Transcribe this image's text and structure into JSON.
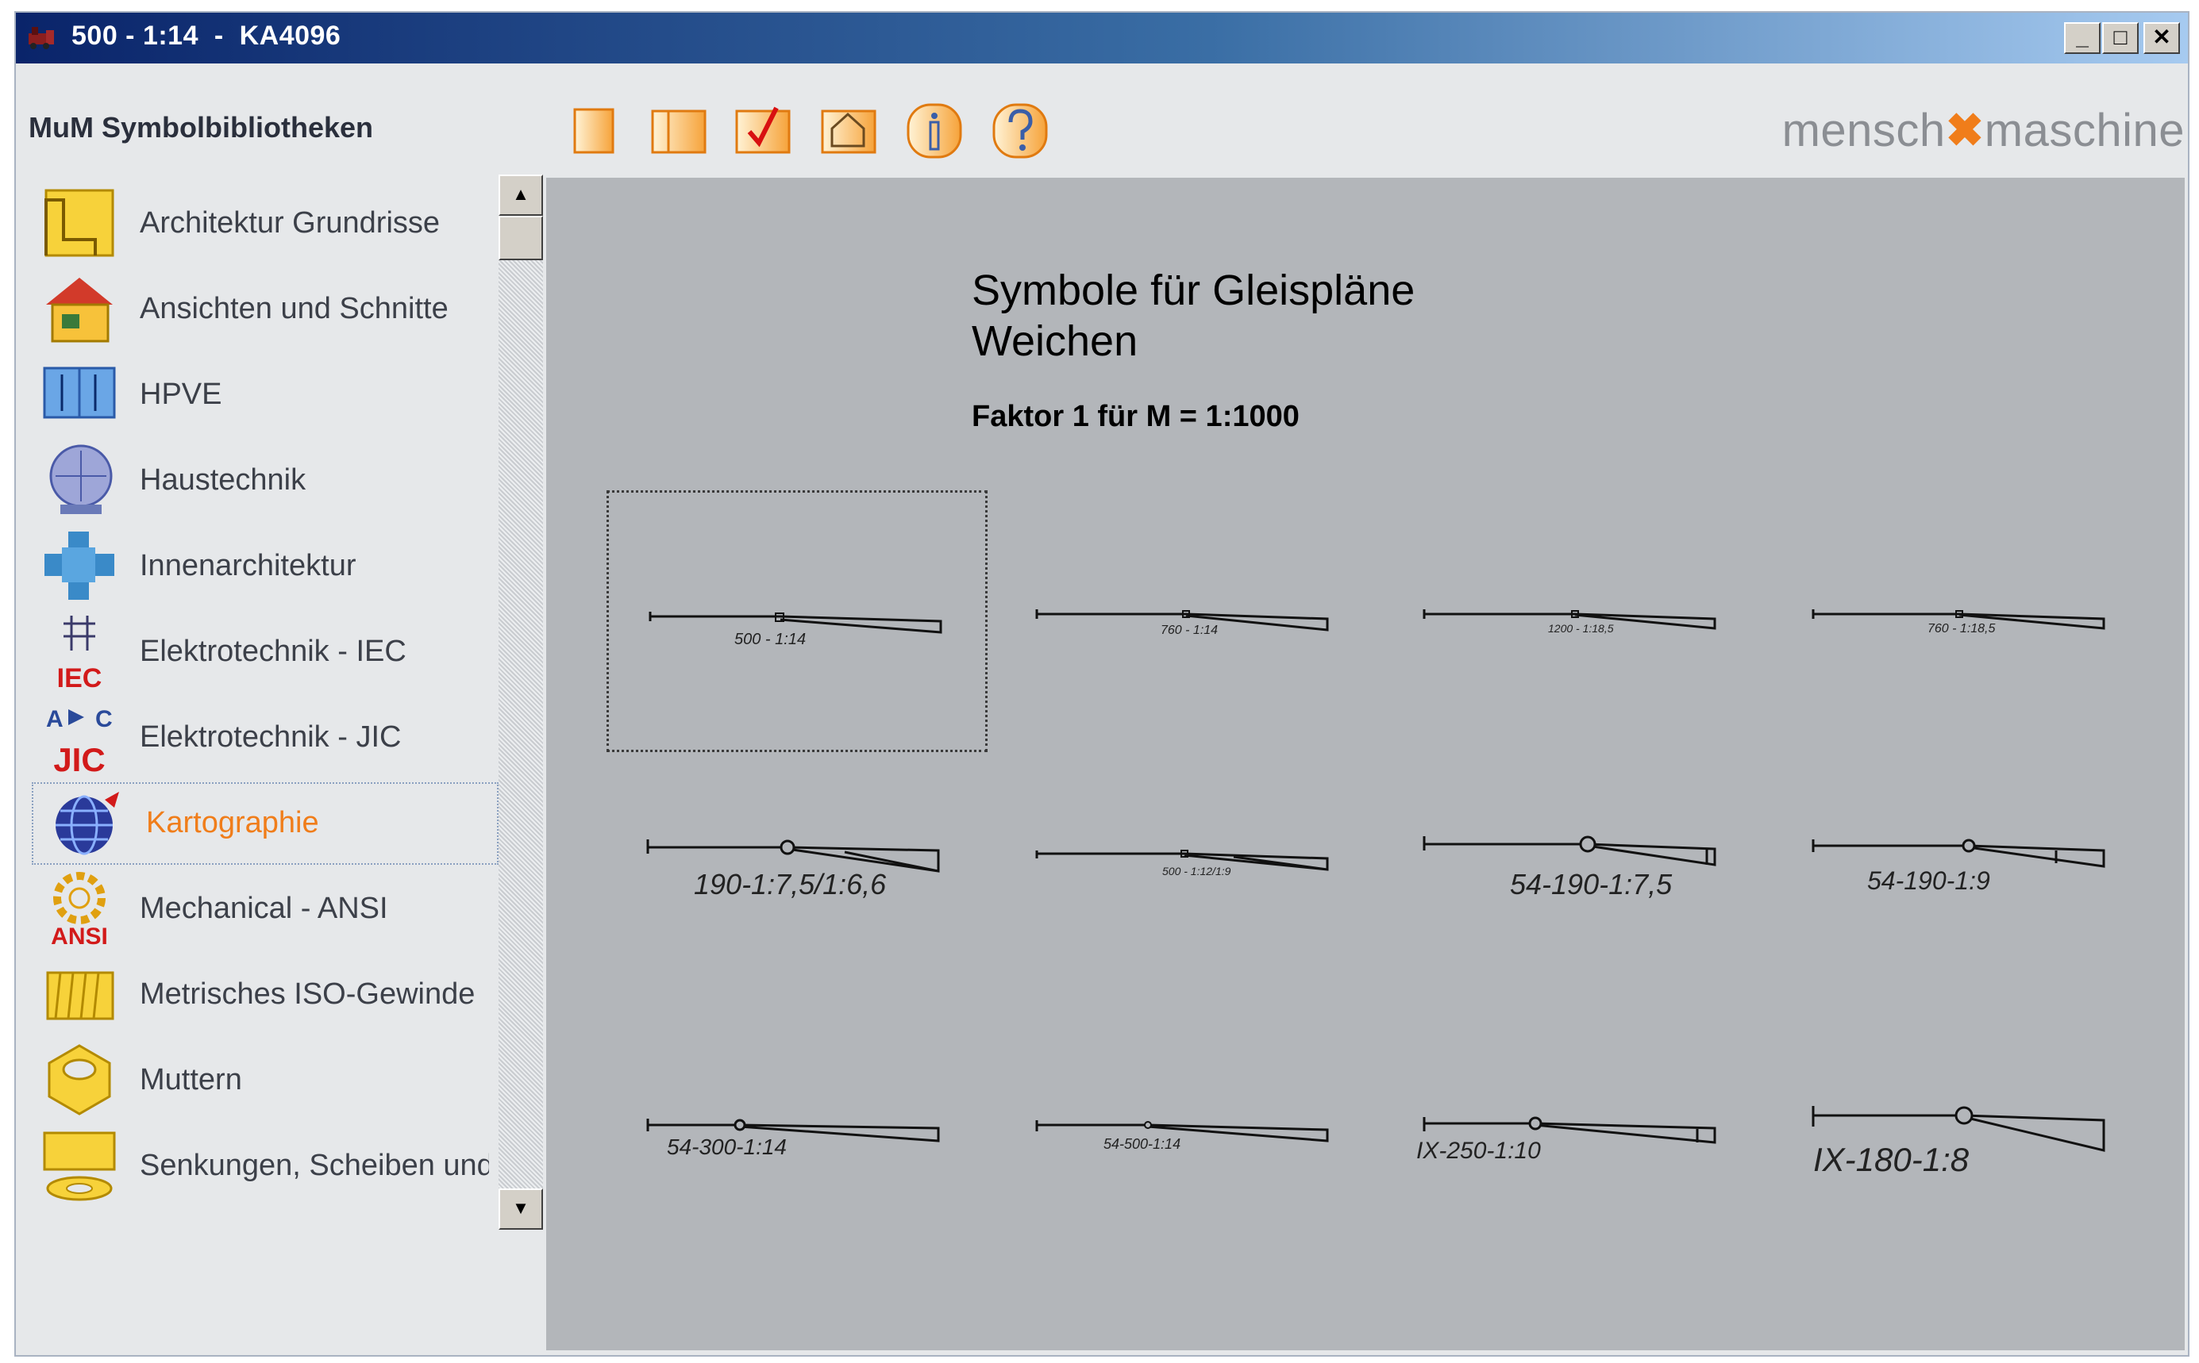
{
  "window": {
    "title": "500 - 1:14  -  KA4096",
    "controls": {
      "minimize": "_",
      "maximize": "□",
      "close": "✕"
    }
  },
  "header": {
    "library_title": "MuM Symbolbibliotheken",
    "brand_left": "mensch",
    "brand_right": "maschine",
    "toolbar_icons": [
      "page-icon",
      "book-icon",
      "checkmark-icon",
      "house-outline-icon",
      "info-icon",
      "help-icon"
    ]
  },
  "sidebar": {
    "items": [
      {
        "label": "Architektur Grundrisse",
        "icon": "floorplan-icon"
      },
      {
        "label": "Ansichten und Schnitte",
        "icon": "house-icon"
      },
      {
        "label": "HPVE",
        "icon": "hpve-icon"
      },
      {
        "label": "Haustechnik",
        "icon": "hvac-icon"
      },
      {
        "label": "Innenarchitektur",
        "icon": "interior-icon"
      },
      {
        "label": "Elektrotechnik - IEC",
        "icon": "iec-icon",
        "badge": "IEC"
      },
      {
        "label": "Elektrotechnik - JIC",
        "icon": "jic-icon",
        "badge": "JIC"
      },
      {
        "label": "Kartographie",
        "icon": "globe-icon",
        "selected": true
      },
      {
        "label": "Mechanical - ANSI",
        "icon": "ansi-icon",
        "badge": "ANSI"
      },
      {
        "label": "Metrisches ISO-Gewinde",
        "icon": "thread-icon"
      },
      {
        "label": "Muttern",
        "icon": "nut-icon"
      },
      {
        "label": "Senkungen, Scheiben und Du",
        "icon": "washer-icon"
      }
    ]
  },
  "main": {
    "heading_line1": "Symbole für Gleispläne",
    "heading_line2": "Weichen",
    "subheading": "Faktor 1 für M = 1:1000",
    "symbols": [
      {
        "caption": "500 - 1:14",
        "selected": true
      },
      {
        "caption": "760 - 1:14"
      },
      {
        "caption": "1200 - 1:18,5"
      },
      {
        "caption": "760 - 1:18,5"
      },
      {
        "caption": "190-1:7,5/1:6,6"
      },
      {
        "caption": "500 - 1:12/1:9"
      },
      {
        "caption": "54-190-1:7,5"
      },
      {
        "caption": "54-190-1:9"
      },
      {
        "caption": "54-300-1:14"
      },
      {
        "caption": "54-500-1:14"
      },
      {
        "caption": "IX-250-1:10"
      },
      {
        "caption": "IX-180-1:8"
      }
    ]
  }
}
